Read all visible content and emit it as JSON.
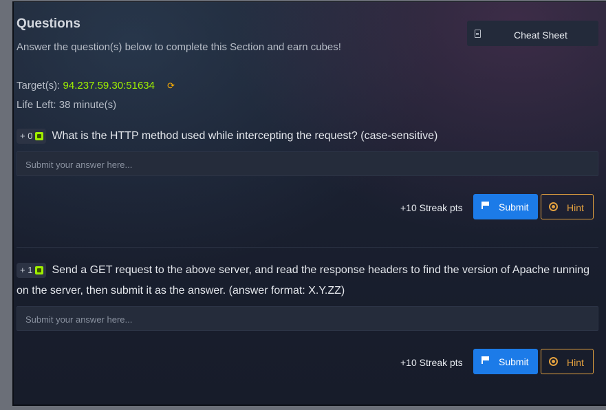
{
  "section": {
    "title": "Questions",
    "subtitle": "Answer the question(s) below to complete this Section and earn cubes!",
    "cheat_sheet_label": "Cheat Sheet"
  },
  "target": {
    "label": "Target(s):",
    "value": "94.237.59.30:51634",
    "refresh_icon": "refresh-icon"
  },
  "life": {
    "text": "Life Left: 38 minute(s)"
  },
  "questions": [
    {
      "badge": "+ 0",
      "text": "What is the HTTP method used while intercepting the request? (case-sensitive)",
      "placeholder": "Submit your answer here...",
      "streak": "+10 Streak pts",
      "submit_label": "Submit",
      "hint_label": "Hint"
    },
    {
      "badge": "+ 1",
      "text": "Send a GET request to the above server, and read the response headers to find the version of Apache running on the server, then submit it as the answer. (answer format: X.Y.ZZ)",
      "placeholder": "Submit your answer here...",
      "streak": "+10 Streak pts",
      "submit_label": "Submit",
      "hint_label": "Hint"
    }
  ],
  "colors": {
    "accent_green": "#9fef00",
    "submit_blue": "#1c7be8",
    "hint_orange": "#e2a03f"
  }
}
